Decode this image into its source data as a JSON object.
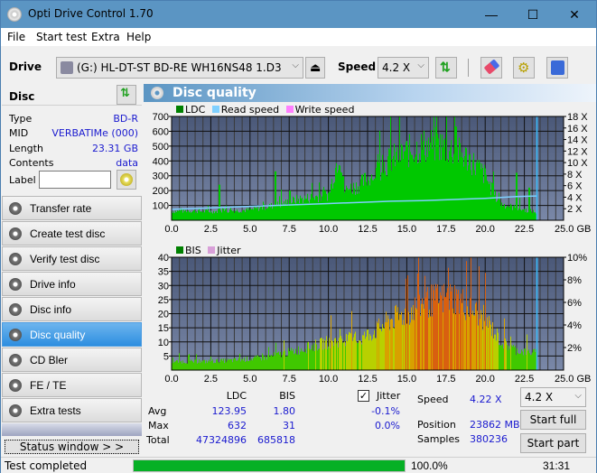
{
  "window": {
    "title": "Opti Drive Control 1.70",
    "controls": {
      "minimize": "—",
      "maximize": "☐",
      "close": "✕"
    }
  },
  "menu": [
    "File",
    "Start test",
    "Extra",
    "Help"
  ],
  "toolbar": {
    "drive_label": "Drive",
    "drive_value": "(G:)  HL-DT-ST BD-RE  WH16NS48 1.D3",
    "speed_label": "Speed",
    "speed_value": "4.2 X",
    "icons": [
      "eject-icon",
      "refresh-icon",
      "eraser-icon",
      "settings-icon",
      "save-icon"
    ]
  },
  "disc": {
    "header": "Disc",
    "fields": [
      {
        "key": "Type",
        "value": "BD-R"
      },
      {
        "key": "MID",
        "value": "VERBATIMe (000)"
      },
      {
        "key": "Length",
        "value": "23.31 GB"
      },
      {
        "key": "Contents",
        "value": "data"
      }
    ],
    "label_key": "Label",
    "label_value": ""
  },
  "nav": [
    {
      "label": "Transfer rate",
      "active": false
    },
    {
      "label": "Create test disc",
      "active": false
    },
    {
      "label": "Verify test disc",
      "active": false
    },
    {
      "label": "Drive info",
      "active": false
    },
    {
      "label": "Disc info",
      "active": false
    },
    {
      "label": "Disc quality",
      "active": true
    },
    {
      "label": "CD Bler",
      "active": false
    },
    {
      "label": "FE / TE",
      "active": false
    },
    {
      "label": "Extra tests",
      "active": false
    }
  ],
  "status_window_label": "Status window > >",
  "panel_title": "Disc quality",
  "chart_data": [
    {
      "type": "area",
      "title": "LDC",
      "legend": [
        "LDC",
        "Read speed",
        "Write speed"
      ],
      "colors": {
        "LDC": "#00c800",
        "Read speed": "#7fd0ff",
        "Write speed": "#ff80ff"
      },
      "xlabel": "GB",
      "xlim": [
        0,
        25
      ],
      "x_ticks": [
        "0.0",
        "2.5",
        "5.0",
        "7.5",
        "10.0",
        "12.5",
        "15.0",
        "17.5",
        "20.0",
        "22.5",
        "25.0 GB"
      ],
      "ylim": [
        0,
        700
      ],
      "y_ticks": [
        "100",
        "200",
        "300",
        "400",
        "500",
        "600",
        "700"
      ],
      "y2lim": [
        0,
        18
      ],
      "y2_ticks": [
        "2 X",
        "4 X",
        "6 X",
        "8 X",
        "10 X",
        "12 X",
        "14 X",
        "16 X",
        "18 X"
      ],
      "end_position_gb": 23.3,
      "series": [
        {
          "name": "LDC",
          "x": [
            0,
            1,
            2,
            3,
            4,
            5,
            6,
            7,
            8,
            9,
            10,
            10.7,
            11,
            12,
            13,
            14,
            15,
            16,
            17,
            18,
            19,
            20,
            20.5,
            21,
            22,
            23,
            23.3
          ],
          "values": [
            60,
            65,
            60,
            60,
            65,
            70,
            90,
            110,
            140,
            155,
            175,
            470,
            200,
            240,
            330,
            410,
            460,
            500,
            510,
            470,
            410,
            300,
            180,
            110,
            80,
            60,
            50
          ]
        },
        {
          "name": "Read speed",
          "x": [
            0,
            2,
            4,
            6,
            8,
            10,
            12,
            14,
            16,
            18,
            20,
            22,
            23.3
          ],
          "values": [
            1.9,
            2.1,
            2.3,
            2.5,
            2.7,
            2.9,
            3.1,
            3.3,
            3.4,
            3.6,
            3.8,
            4.1,
            4.2
          ]
        }
      ],
      "spikes": [
        {
          "x": 3.0,
          "v": 240
        },
        {
          "x": 6.6,
          "v": 330
        },
        {
          "x": 7.5,
          "v": 200
        },
        {
          "x": 11.3,
          "v": 210
        },
        {
          "x": 12.8,
          "v": 270
        },
        {
          "x": 18.1,
          "v": 632
        },
        {
          "x": 22.0,
          "v": 320
        },
        {
          "x": 22.8,
          "v": 220
        }
      ]
    },
    {
      "type": "bar",
      "title": "BIS",
      "legend": [
        "BIS",
        "Jitter"
      ],
      "colors": {
        "BIS": "#00c800",
        "Jitter": "#d8a0d8"
      },
      "xlabel": "GB",
      "xlim": [
        0,
        25
      ],
      "x_ticks": [
        "0.0",
        "2.5",
        "5.0",
        "7.5",
        "10.0",
        "12.5",
        "15.0",
        "17.5",
        "20.0",
        "22.5",
        "25.0 GB"
      ],
      "ylim": [
        0,
        40
      ],
      "y_ticks": [
        "5",
        "10",
        "15",
        "20",
        "25",
        "30",
        "35",
        "40"
      ],
      "y2lim": [
        0,
        10
      ],
      "y2_ticks": [
        "2%",
        "4%",
        "6%",
        "8%",
        "10%"
      ],
      "end_position_gb": 23.3,
      "series": [
        {
          "name": "BIS",
          "x": [
            0,
            2,
            4,
            6,
            8,
            10,
            12,
            13,
            14,
            15,
            16,
            17,
            18,
            19,
            20,
            21,
            22,
            23.3
          ],
          "values": [
            3,
            3,
            3.5,
            4.5,
            7,
            10,
            11,
            14,
            18,
            20,
            24,
            25,
            26,
            22,
            18,
            10,
            7,
            6
          ]
        }
      ],
      "max_value": 31
    }
  ],
  "stats": {
    "col_ldc": "LDC",
    "col_bis": "BIS",
    "jitter_label": "Jitter",
    "jitter_checked": true,
    "rows": [
      {
        "label": "Avg",
        "ldc": "123.95",
        "bis": "1.80",
        "jitter": "-0.1%"
      },
      {
        "label": "Max",
        "ldc": "632",
        "bis": "31",
        "jitter": "0.0%"
      },
      {
        "label": "Total",
        "ldc": "47324896",
        "bis": "685818",
        "jitter": ""
      }
    ],
    "speed_label": "Speed",
    "speed_value": "4.22 X",
    "position_label": "Position",
    "position_value": "23862 MB",
    "samples_label": "Samples",
    "samples_value": "380236",
    "speed_select": "4.2 X",
    "start_full": "Start full",
    "start_part": "Start part"
  },
  "statusbar": {
    "text": "Test completed",
    "progress_percent": 100.0,
    "progress_label": "100.0%",
    "time": "31:31"
  }
}
